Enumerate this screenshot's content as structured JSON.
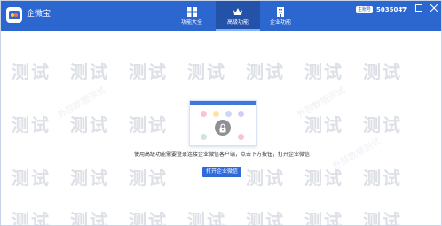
{
  "app": {
    "title": "企微宝",
    "logo_icon": "app-logo-icon"
  },
  "tabs": [
    {
      "label": "功能大全",
      "icon": "grid-icon",
      "active": false
    },
    {
      "label": "高级功能",
      "icon": "crown-icon",
      "active": true
    },
    {
      "label": "企业功能",
      "icon": "building-icon",
      "active": false
    }
  ],
  "account": {
    "label": "主账号",
    "id": "5035047"
  },
  "window_controls": [
    "minimize-icon",
    "maximize-icon",
    "close-icon"
  ],
  "main": {
    "message": "使用高级功能需要登录连接企业微信客户端，点击下方按钮，打开企业微信",
    "open_button_label": "打开企业微信"
  },
  "watermark": {
    "text": "测试",
    "faint_text": "外部数据测试"
  },
  "colors": {
    "titlebar": "#2c67cf",
    "active_tab": "#2452a8",
    "button": "#2f6ad8",
    "watermark": "#dde0e6"
  }
}
